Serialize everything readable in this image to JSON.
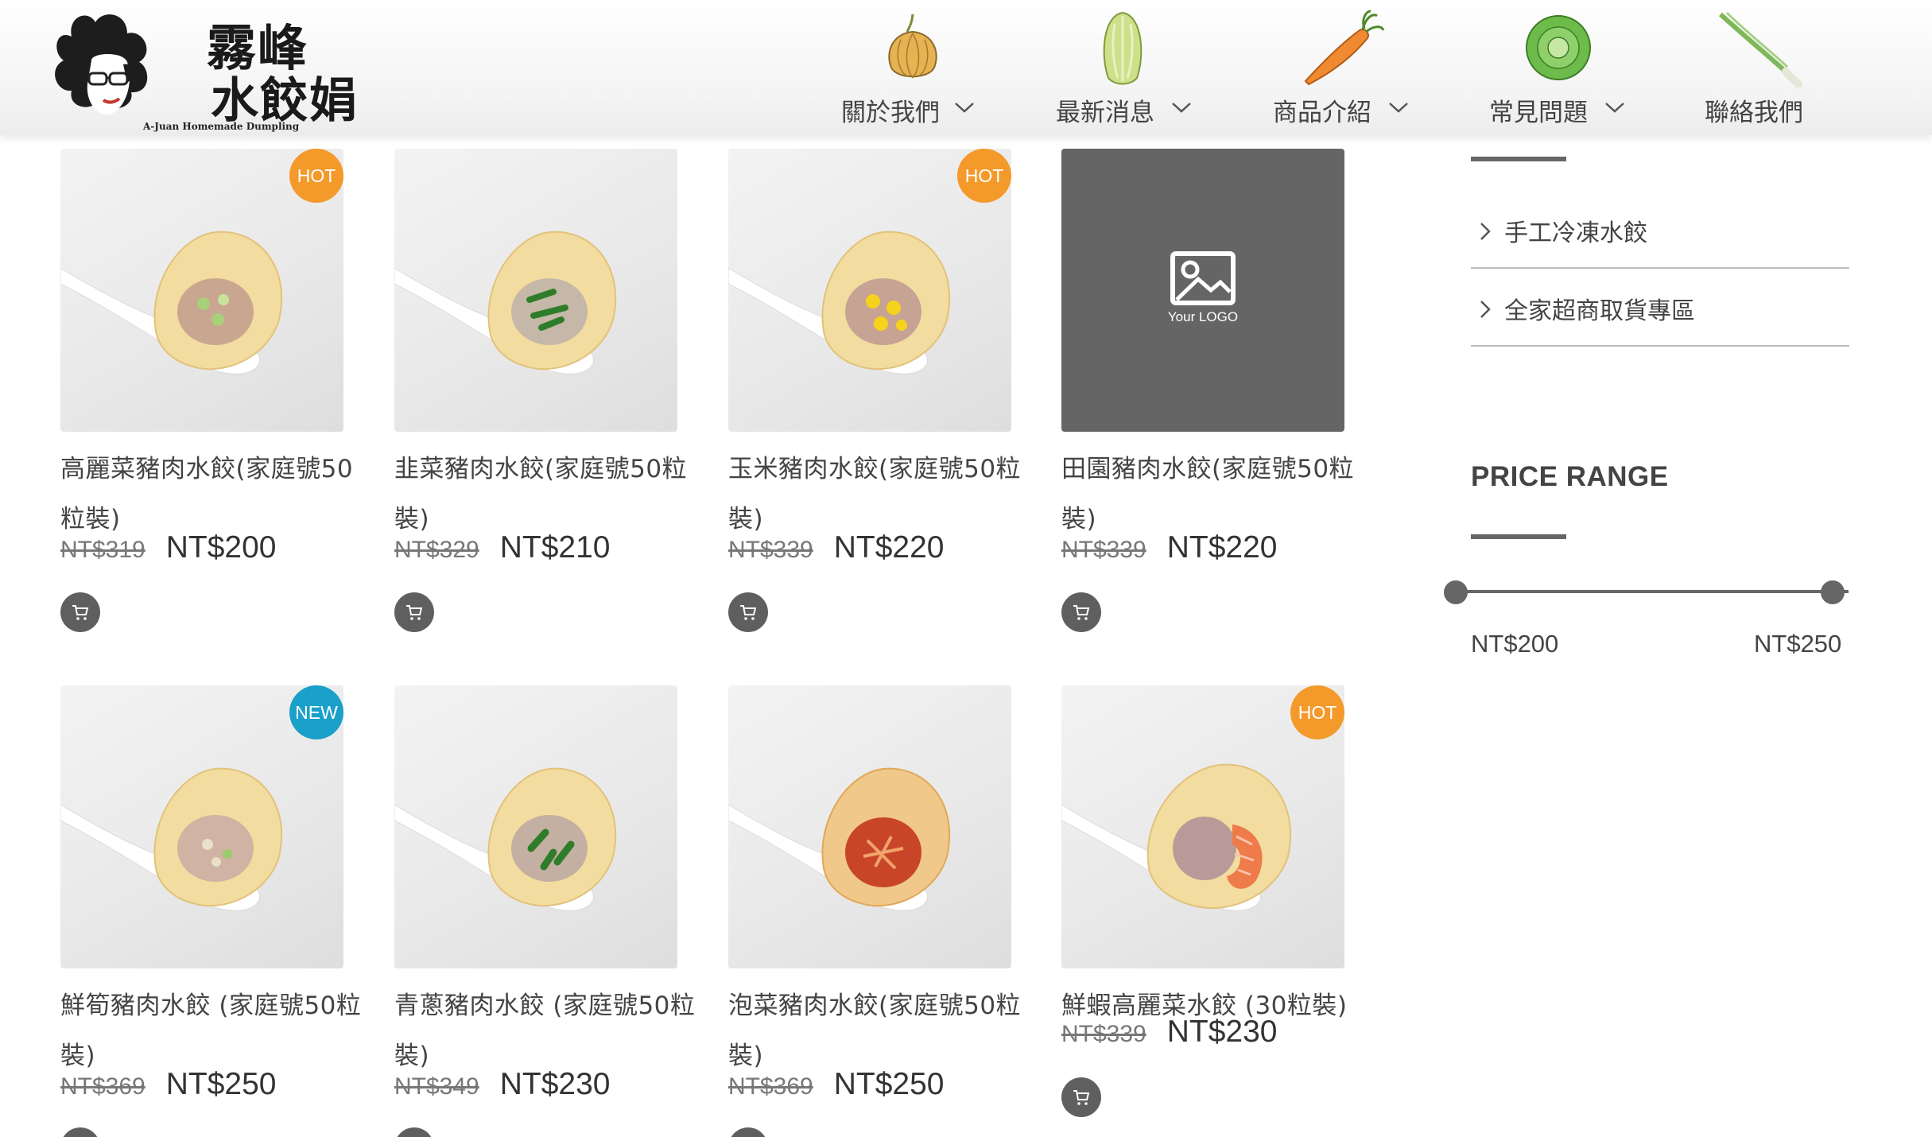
{
  "header": {
    "logo": {
      "name_zh_line1": "霧峰",
      "name_zh_line2": "水餃娟",
      "name_en": "A-Juan Homemade Dumpling"
    },
    "nav": [
      {
        "label": "關於我們",
        "icon": "onion-icon",
        "has_dropdown": true
      },
      {
        "label": "最新消息",
        "icon": "cabbage-icon",
        "has_dropdown": true
      },
      {
        "label": "商品介紹",
        "icon": "carrot-icon",
        "has_dropdown": true
      },
      {
        "label": "常見問題",
        "icon": "lettuce-icon",
        "has_dropdown": true
      },
      {
        "label": "聯絡我們",
        "icon": "scallion-icon",
        "has_dropdown": false
      }
    ]
  },
  "products": [
    {
      "name": "高麗菜豬肉水餃(家庭號50粒裝)",
      "old_price": "NT$319",
      "price": "NT$200",
      "badge": "HOT",
      "filling": "cabbage",
      "cart_icon": "cart-icon"
    },
    {
      "name": "韭菜豬肉水餃(家庭號50粒裝)",
      "old_price": "NT$329",
      "price": "NT$210",
      "badge": "",
      "filling": "chive",
      "cart_icon": "cart-icon"
    },
    {
      "name": "玉米豬肉水餃(家庭號50粒裝)",
      "old_price": "NT$339",
      "price": "NT$220",
      "badge": "HOT",
      "filling": "corn",
      "cart_icon": "cart-icon"
    },
    {
      "name": "田園豬肉水餃(家庭號50粒裝)",
      "old_price": "NT$339",
      "price": "NT$220",
      "badge": "",
      "filling": "placeholder",
      "placeholder_text": "Your LOGO",
      "cart_icon": "cart-icon"
    },
    {
      "name": "鮮筍豬肉水餃 (家庭號50粒裝)",
      "old_price": "NT$369",
      "price": "NT$250",
      "badge": "NEW",
      "filling": "bamboo",
      "cart_icon": "cart-icon"
    },
    {
      "name": "青蔥豬肉水餃 (家庭號50粒裝)",
      "old_price": "NT$349",
      "price": "NT$230",
      "badge": "",
      "filling": "scallion",
      "cart_icon": "cart-icon"
    },
    {
      "name": "泡菜豬肉水餃(家庭號50粒裝)",
      "old_price": "NT$369",
      "price": "NT$250",
      "badge": "",
      "filling": "kimchi",
      "cart_icon": "cart-icon"
    },
    {
      "name": "鮮蝦高麗菜水餃 (30粒裝)",
      "old_price": "NT$339",
      "price": "NT$230",
      "badge": "HOT",
      "filling": "shrimp",
      "cart_icon": "cart-icon"
    }
  ],
  "sidebar": {
    "categories": [
      {
        "label": "手工冷凍水餃"
      },
      {
        "label": "全家超商取貨專區"
      }
    ],
    "price_range": {
      "title": "PRICE RANGE",
      "min_label": "NT$200",
      "max_label": "NT$250",
      "min": 200,
      "max": 250
    }
  },
  "colors": {
    "hot_badge": "#f39a2b",
    "new_badge": "#1aa0c9",
    "cart_button": "#5f5f5f",
    "placeholder_bg": "#656565"
  }
}
